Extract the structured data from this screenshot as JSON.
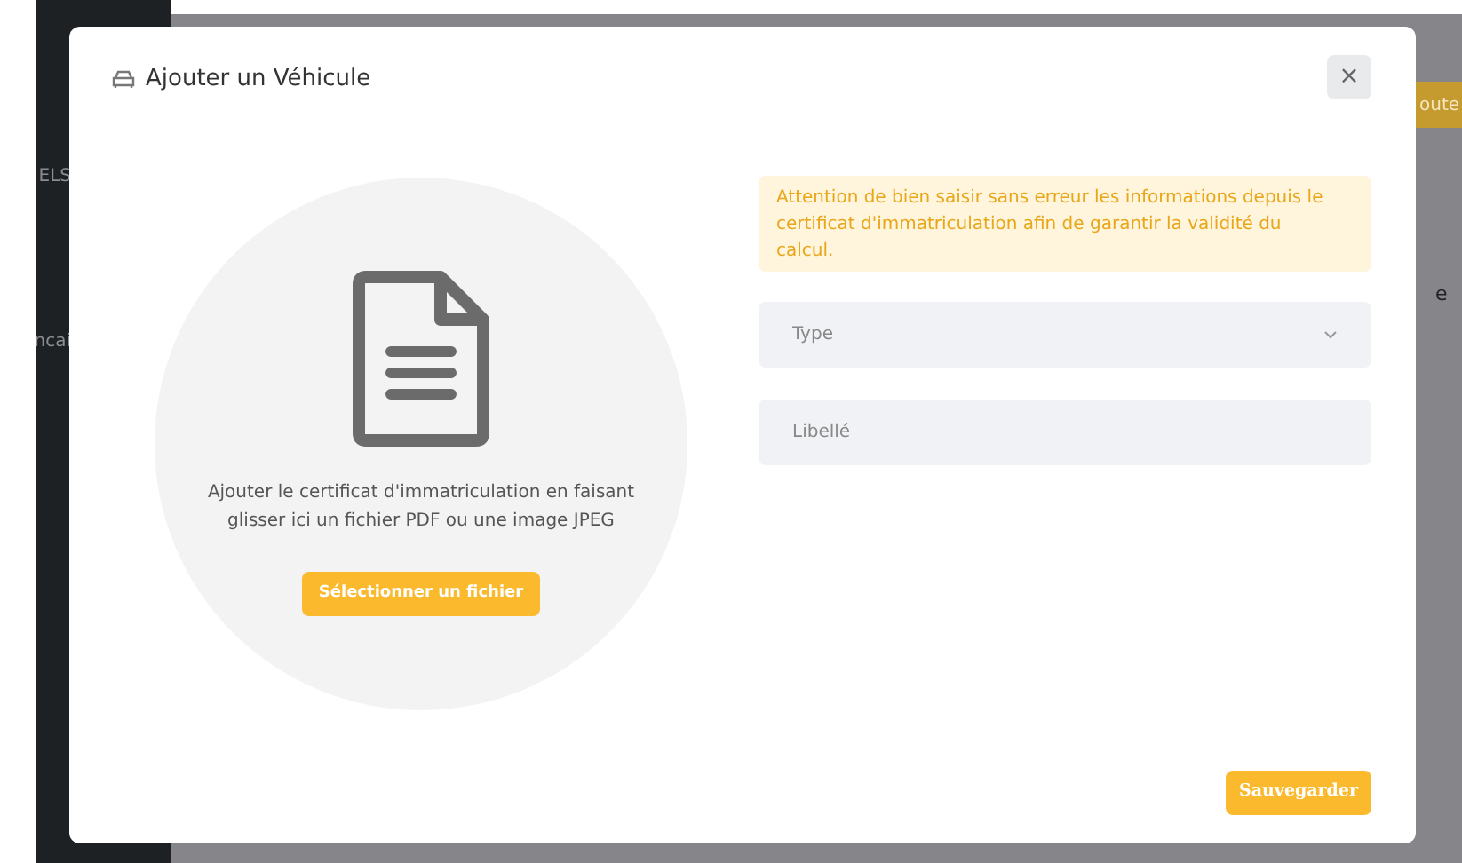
{
  "background": {
    "sidebar_texts": [
      "ELS",
      "ncai"
    ],
    "right_button": "oute",
    "right_text": "e"
  },
  "dialog": {
    "title": "Ajouter un Véhicule",
    "close": "×",
    "dropzone": {
      "text": "Ajouter le certificat d'immatriculation en faisant glisser ici un fichier PDF ou une image JPEG",
      "button": "Sélectionner un fichier"
    },
    "warning": "Attention de bien saisir sans erreur les informations depuis le certificat d'immatriculation afin de garantir la validité du calcul.",
    "fields": [
      {
        "kind": "select",
        "placeholder": "Type"
      },
      {
        "kind": "text",
        "placeholder": "Libellé"
      }
    ],
    "save_button": "Sauvegarder"
  }
}
